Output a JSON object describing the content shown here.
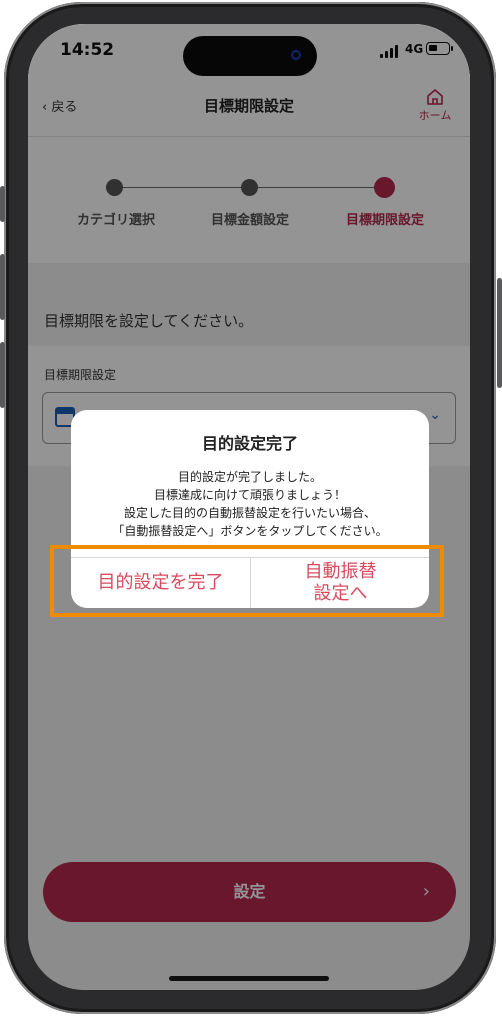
{
  "status_bar": {
    "time": "14:52",
    "network": "4G"
  },
  "nav": {
    "back_label": "戻る",
    "title": "目標期限設定",
    "home_label": "ホーム"
  },
  "stepper": {
    "steps": [
      {
        "label": "カテゴリ選択"
      },
      {
        "label": "目標金額設定"
      },
      {
        "label": "目標期限設定"
      }
    ],
    "active_index": 2
  },
  "form": {
    "instruction": "目標期限を設定してください。",
    "field_label": "目標期限設定"
  },
  "submit": {
    "label": "設定",
    "arrow": "›"
  },
  "modal": {
    "title": "目的設定完了",
    "message_lines": [
      "目的設定が完了しました。",
      "目標達成に向けて頑張りましょう！",
      "設定した目的の自動振替設定を行いたい場合、",
      "「自動振替設定へ」ボタンをタップしてください。"
    ],
    "finish_button": "目的設定を完了",
    "auto_transfer_button_line1": "自動振替",
    "auto_transfer_button_line2": "設定へ"
  },
  "colors": {
    "brand": "#b5294e",
    "highlight": "#f08a00",
    "modal_button_text": "#d94a5e"
  },
  "icons": {
    "back": "chevron-left-icon",
    "home": "home-icon",
    "calendar": "calendar-icon",
    "dropdown": "chevron-down-icon"
  }
}
